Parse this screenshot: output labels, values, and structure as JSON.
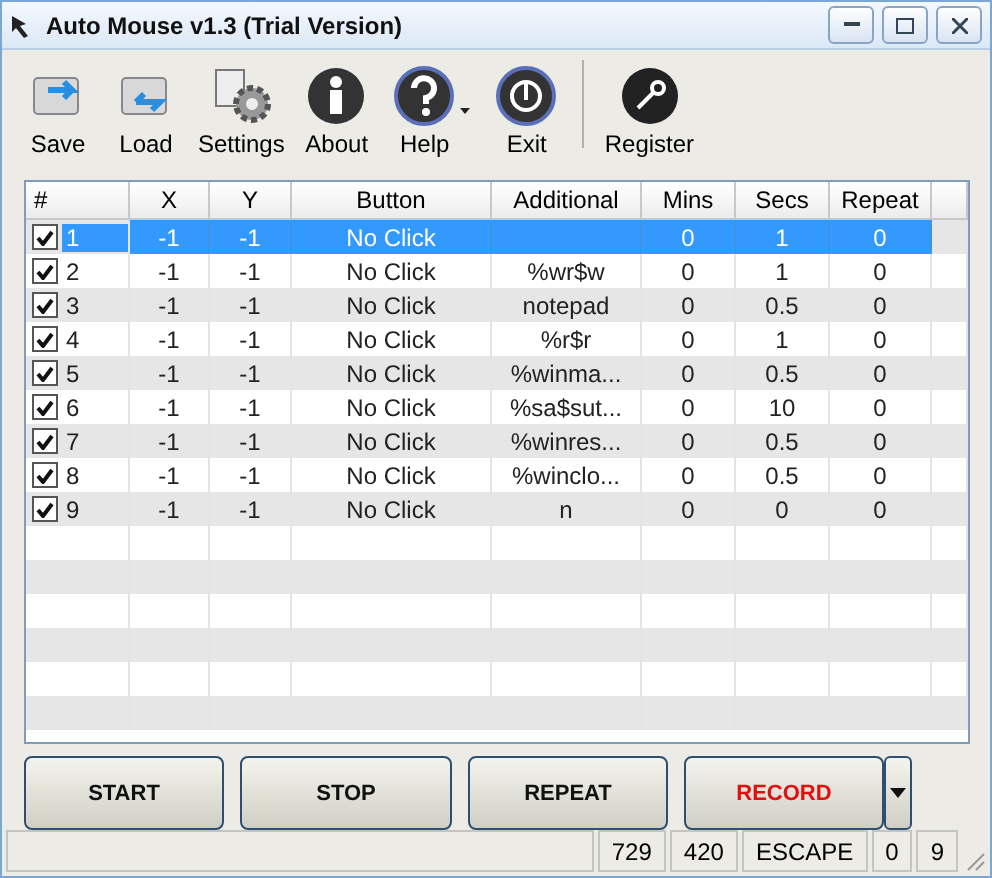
{
  "window": {
    "title": "Auto Mouse v1.3 (Trial Version)"
  },
  "toolbar": [
    {
      "kind": "save",
      "label": "Save"
    },
    {
      "kind": "load",
      "label": "Load"
    },
    {
      "kind": "settings",
      "label": "Settings"
    },
    {
      "kind": "about",
      "label": "About"
    },
    {
      "kind": "help",
      "label": "Help"
    },
    {
      "kind": "exit",
      "label": "Exit"
    },
    {
      "kind": "register",
      "label": "Register"
    }
  ],
  "table": {
    "columns": [
      "#",
      "X",
      "Y",
      "Button",
      "Additional",
      "Mins",
      "Secs",
      "Repeat"
    ],
    "rows": [
      {
        "checked": true,
        "selected": true,
        "cells": [
          "1",
          "-1",
          "-1",
          "No Click",
          "",
          "0",
          "1",
          "0"
        ]
      },
      {
        "checked": true,
        "selected": false,
        "cells": [
          "2",
          "-1",
          "-1",
          "No Click",
          "%wr$w",
          "0",
          "1",
          "0"
        ]
      },
      {
        "checked": true,
        "selected": false,
        "cells": [
          "3",
          "-1",
          "-1",
          "No Click",
          "notepad",
          "0",
          "0.5",
          "0"
        ]
      },
      {
        "checked": true,
        "selected": false,
        "cells": [
          "4",
          "-1",
          "-1",
          "No Click",
          "%r$r",
          "0",
          "1",
          "0"
        ]
      },
      {
        "checked": true,
        "selected": false,
        "cells": [
          "5",
          "-1",
          "-1",
          "No Click",
          "%winma...",
          "0",
          "0.5",
          "0"
        ]
      },
      {
        "checked": true,
        "selected": false,
        "cells": [
          "6",
          "-1",
          "-1",
          "No Click",
          "%sa$sut...",
          "0",
          "10",
          "0"
        ]
      },
      {
        "checked": true,
        "selected": false,
        "cells": [
          "7",
          "-1",
          "-1",
          "No Click",
          "%winres...",
          "0",
          "0.5",
          "0"
        ]
      },
      {
        "checked": true,
        "selected": false,
        "cells": [
          "8",
          "-1",
          "-1",
          "No Click",
          "%winclo...",
          "0",
          "0.5",
          "0"
        ]
      },
      {
        "checked": true,
        "selected": false,
        "cells": [
          "9",
          "-1",
          "-1",
          "No Click",
          "n",
          "0",
          "0",
          "0"
        ]
      }
    ]
  },
  "buttons": [
    {
      "label": "START",
      "kind": "normal"
    },
    {
      "label": "STOP",
      "kind": "normal"
    },
    {
      "label": "REPEAT",
      "kind": "normal"
    },
    {
      "label": "RECORD",
      "kind": "alert"
    }
  ],
  "status_bar": [
    "729",
    "420",
    "ESCAPE",
    "0",
    "9"
  ]
}
